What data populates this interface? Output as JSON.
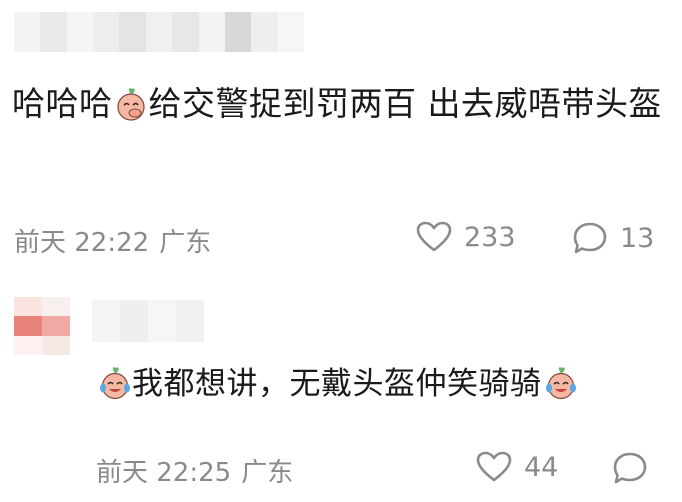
{
  "comment1": {
    "text_a": "哈哈哈",
    "emoji_a": "covering-mouth-laugh-emoji",
    "text_b": "给交警捉到罚两百 出去威唔带头盔",
    "time": "前天 22:22",
    "location": "广东",
    "likes": "233",
    "replies": "13"
  },
  "comment2": {
    "emoji_start": "crying-laughing-emoji",
    "text": "我都想讲，无戴头盔仲笑骑骑",
    "emoji_end": "crying-laughing-emoji",
    "time": "前天 22:25",
    "location": "广东",
    "likes": "44"
  },
  "colors": {
    "text": "#1a1a1a",
    "meta": "#8a8a8a",
    "avatar_accent": "#e8837a"
  }
}
